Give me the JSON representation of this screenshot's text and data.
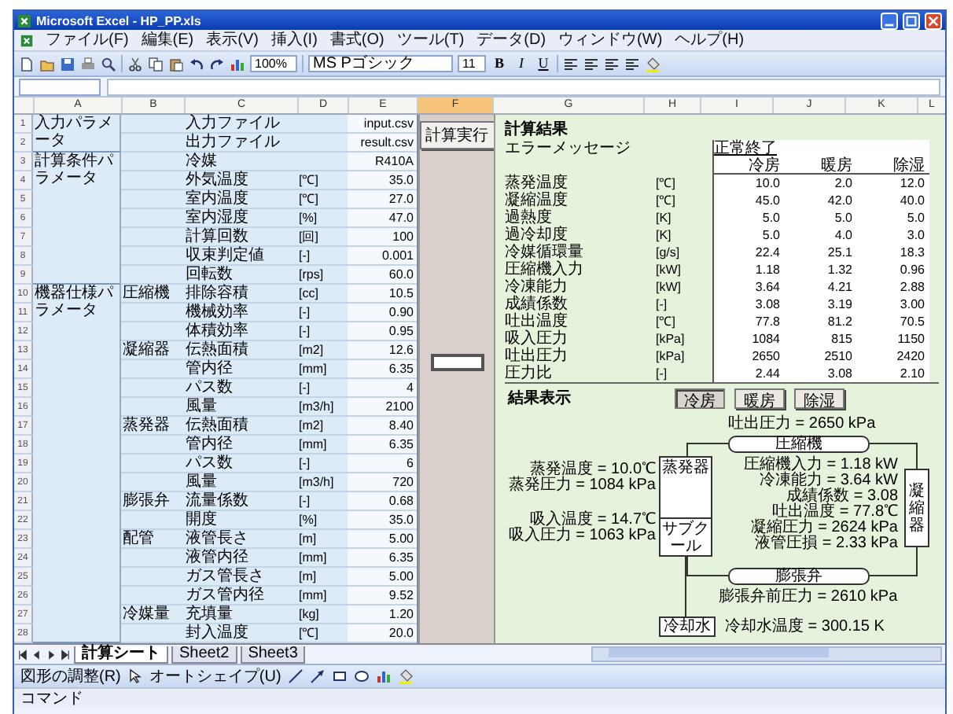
{
  "window": {
    "title": "Microsoft Excel - HP_PP.xls"
  },
  "menu": [
    "ファイル(F)",
    "編集(E)",
    "表示(V)",
    "挿入(I)",
    "書式(O)",
    "ツール(T)",
    "データ(D)",
    "ウィンドウ(W)",
    "ヘルプ(H)"
  ],
  "toolbar": {
    "zoom": "100%",
    "font": "MS Pゴシック",
    "size": "11",
    "format_buttons": [
      "B",
      "I",
      "U"
    ]
  },
  "columns": [
    {
      "label": "A",
      "selected": false
    },
    {
      "label": "B",
      "selected": false
    },
    {
      "label": "C",
      "selected": false
    },
    {
      "label": "D",
      "selected": false
    },
    {
      "label": "E",
      "selected": false
    },
    {
      "label": "F",
      "selected": true
    },
    {
      "label": "G",
      "selected": false
    },
    {
      "label": "H",
      "selected": false
    },
    {
      "label": "I",
      "selected": false
    },
    {
      "label": "J",
      "selected": false
    },
    {
      "label": "K",
      "selected": false
    },
    {
      "label": "L",
      "selected": false
    }
  ],
  "parameters": [
    {
      "section": "入力パラメータ",
      "rows": [
        {
          "n": "1",
          "item": "入力ファイル",
          "value": "input.csv"
        },
        {
          "n": "2",
          "item": "出力ファイル",
          "value": "result.csv"
        }
      ]
    },
    {
      "section": "計算条件パラメータ",
      "rows": [
        {
          "n": "3",
          "item": "冷媒",
          "value": "R410A"
        },
        {
          "n": "4",
          "item": "外気温度",
          "unit": "[℃]",
          "value": "35.0"
        },
        {
          "n": "5",
          "item": "室内温度",
          "unit": "[℃]",
          "value": "27.0"
        },
        {
          "n": "6",
          "item": "室内湿度",
          "unit": "[%]",
          "value": "47.0"
        },
        {
          "n": "7",
          "item": "計算回数",
          "unit": "[回]",
          "value": "100"
        },
        {
          "n": "8",
          "item": "収束判定値",
          "unit": "[-]",
          "value": "0.001"
        },
        {
          "n": "9",
          "item": "回転数",
          "unit": "[rps]",
          "value": "60.0"
        }
      ]
    },
    {
      "section": "機器仕様パラメータ",
      "rows": [
        {
          "n": "10",
          "group": "圧縮機",
          "item": "排除容積",
          "unit": "[cc]",
          "value": "10.5"
        },
        {
          "n": "11",
          "item": "機械効率",
          "unit": "[-]",
          "value": "0.90"
        },
        {
          "n": "12",
          "item": "体積効率",
          "unit": "[-]",
          "value": "0.95"
        },
        {
          "n": "13",
          "group": "凝縮器",
          "item": "伝熱面積",
          "unit": "[m2]",
          "value": "12.6"
        },
        {
          "n": "14",
          "item": "管内径",
          "unit": "[mm]",
          "value": "6.35"
        },
        {
          "n": "15",
          "item": "パス数",
          "unit": "[-]",
          "value": "4"
        },
        {
          "n": "16",
          "item": "風量",
          "unit": "[m3/h]",
          "value": "2100"
        },
        {
          "n": "17",
          "group": "蒸発器",
          "item": "伝熱面積",
          "unit": "[m2]",
          "value": "8.40"
        },
        {
          "n": "18",
          "item": "管内径",
          "unit": "[mm]",
          "value": "6.35"
        },
        {
          "n": "19",
          "item": "パス数",
          "unit": "[-]",
          "value": "6"
        },
        {
          "n": "20",
          "item": "風量",
          "unit": "[m3/h]",
          "value": "720"
        },
        {
          "n": "21",
          "group": "膨張弁",
          "item": "流量係数",
          "unit": "[-]",
          "value": "0.68"
        },
        {
          "n": "22",
          "item": "開度",
          "unit": "[%]",
          "value": "35.0"
        },
        {
          "n": "23",
          "group": "配管",
          "item": "液管長さ",
          "unit": "[m]",
          "value": "5.00"
        },
        {
          "n": "24",
          "item": "液管内径",
          "unit": "[mm]",
          "value": "6.35"
        },
        {
          "n": "25",
          "item": "ガス管長さ",
          "unit": "[m]",
          "value": "5.00"
        },
        {
          "n": "26",
          "item": "ガス管内径",
          "unit": "[mm]",
          "value": "9.52"
        },
        {
          "n": "27",
          "group": "冷媒量",
          "item": "充填量",
          "unit": "[kg]",
          "value": "1.20"
        },
        {
          "n": "28",
          "item": "封入温度",
          "unit": "[℃]",
          "value": "20.0"
        }
      ]
    }
  ],
  "run_button": "計算実行",
  "results": {
    "title": "計算結果",
    "error_label": "エラーメッセージ",
    "status": "正常終了",
    "columns": [
      "冷房",
      "暖房",
      "除湿"
    ],
    "rows": [
      {
        "item": "蒸発温度",
        "unit": "[℃]",
        "values": [
          "10.0",
          "2.0",
          "12.0"
        ]
      },
      {
        "item": "凝縮温度",
        "unit": "[℃]",
        "values": [
          "45.0",
          "42.0",
          "40.0"
        ]
      },
      {
        "item": "過熱度",
        "unit": "[K]",
        "values": [
          "5.0",
          "5.0",
          "5.0"
        ]
      },
      {
        "item": "過冷却度",
        "unit": "[K]",
        "values": [
          "5.0",
          "4.0",
          "3.0"
        ]
      },
      {
        "item": "冷媒循環量",
        "unit": "[g/s]",
        "values": [
          "22.4",
          "25.1",
          "18.3"
        ]
      },
      {
        "item": "圧縮機入力",
        "unit": "[kW]",
        "values": [
          "1.18",
          "1.32",
          "0.96"
        ]
      },
      {
        "item": "冷凍能力",
        "unit": "[kW]",
        "values": [
          "3.64",
          "4.21",
          "2.88"
        ]
      },
      {
        "item": "成績係数",
        "unit": "[-]",
        "values": [
          "3.08",
          "3.19",
          "3.00"
        ]
      },
      {
        "item": "吐出温度",
        "unit": "[℃]",
        "values": [
          "77.8",
          "81.2",
          "70.5"
        ]
      },
      {
        "item": "吸入圧力",
        "unit": "[kPa]",
        "values": [
          "1084",
          "815",
          "1150"
        ]
      },
      {
        "item": "吐出圧力",
        "unit": "[kPa]",
        "values": [
          "2650",
          "2510",
          "2420"
        ]
      },
      {
        "item": "圧力比",
        "unit": "[-]",
        "values": [
          "2.44",
          "3.08",
          "2.10"
        ]
      }
    ]
  },
  "diagram": {
    "title": "結果表示",
    "buttons": [
      {
        "label": "冷房",
        "selected": true
      },
      {
        "label": "暖房",
        "selected": false
      },
      {
        "label": "除湿",
        "selected": false
      }
    ],
    "compressor": {
      "label": "圧縮機",
      "reading": "吐出圧力 = 2650 kPa"
    },
    "valve": {
      "label": "膨張弁",
      "reading": "膨張弁前圧力 = 2610 kPa"
    },
    "evaporator": {
      "label": "蒸発器",
      "inner": "サブクール"
    },
    "condenser": {
      "label": "凝縮器"
    },
    "coolant": {
      "label": "冷却水",
      "reading": "冷却水温度 = 300.15 K"
    },
    "left_readings": [
      "蒸発温度 = 10.0℃",
      "蒸発圧力 = 1084 kPa",
      "吸入温度 = 14.7℃",
      "吸入圧力 = 1063 kPa"
    ],
    "right_readings": [
      "圧縮機入力 = 1.18 kW",
      "冷凍能力 = 3.64 kW",
      "成績係数 = 3.08",
      "吐出温度 = 77.8℃",
      "凝縮圧力 = 2624 kPa",
      "液管圧損 = 2.33 kPa"
    ]
  },
  "sheet_tabs": [
    {
      "label": "計算シート",
      "selected": true
    },
    {
      "label": "Sheet2",
      "selected": false
    },
    {
      "label": "Sheet3",
      "selected": false
    }
  ],
  "draw_toolbar": {
    "adjust": "図形の調整(R)",
    "autoshape": "オートシェイプ(U)"
  },
  "status_bar": "コマンド"
}
